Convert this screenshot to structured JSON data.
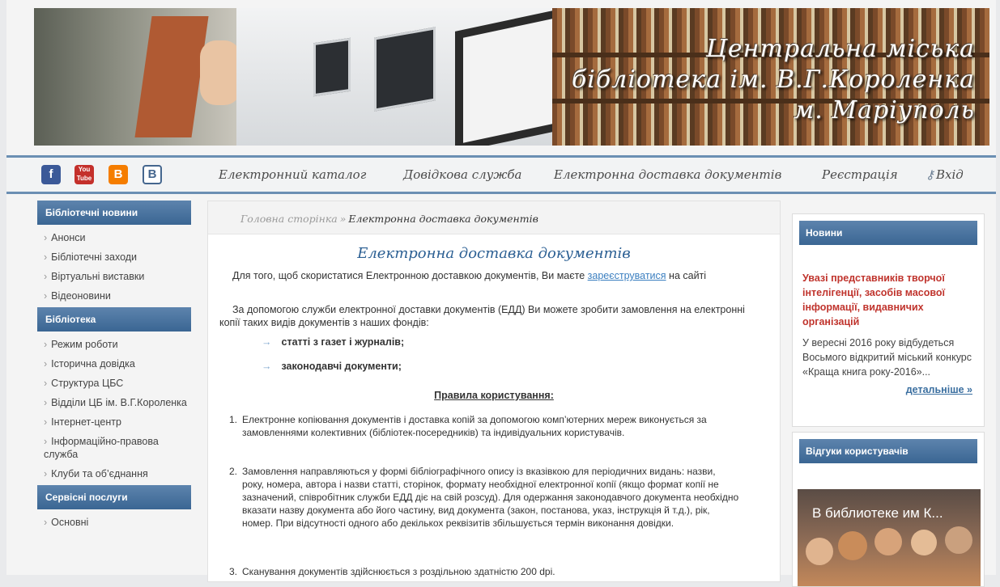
{
  "header": {
    "banner_lines": [
      "Центральна міська",
      "бібліотека ім. В.Г.Короленка",
      "м. Маріуполь"
    ]
  },
  "social": {
    "items": [
      {
        "name": "facebook-icon",
        "glyph": "f"
      },
      {
        "name": "youtube-icon",
        "glyph": "You Tube"
      },
      {
        "name": "blogger-icon",
        "glyph": "B"
      },
      {
        "name": "vkontakte-icon",
        "glyph": "B"
      }
    ]
  },
  "nav": {
    "items": [
      "Електронний каталог",
      "Довідкова служба",
      "Електронна доставка документів",
      "Реєстрація",
      "Вхід"
    ],
    "login_icon": "key-icon"
  },
  "left": {
    "sections": [
      {
        "title": "Бібліотечні новини",
        "items": [
          "Анонси",
          "Бібліотечні заходи",
          "Віртуальні виставки",
          "Відеоновини"
        ]
      },
      {
        "title": "Бібліотека",
        "items": [
          "Режим роботи",
          "Історична довідка",
          "Структура ЦБС",
          "Відділи ЦБ ім. В.Г.Короленка",
          "Інтернет-центр",
          "Інформаційно-правова служба",
          "Клуби та об’єднання"
        ]
      },
      {
        "title": "Сервісні послуги",
        "items": [
          "Основні"
        ]
      }
    ]
  },
  "main": {
    "breadcrumb": {
      "home": "Головна сторінка",
      "sep": "»",
      "current": "Електронна доставка документів"
    },
    "title": "Електронна доставка документів",
    "intro_before": "Для того, щоб скористатися Електронною доставкою документів, Ви маєте ",
    "intro_link": "зареєструватися",
    "intro_after": " на сайті",
    "para2": "За допомогою служби електронної доставки документів (ЕДД) Ви можете зробити замовлення на електронні копії таких видів документів з наших фондів:",
    "bullets": [
      "статті з газет і журналів;",
      "законодавчі документи;"
    ],
    "rules_title": "Правила користування:",
    "rules": [
      "Електронне копіювання документів і доставка копій за допомогою комп’ютерних мереж виконується за замовленнями колективних (бібліотек-посередників) та індивідуальних користувачів.",
      "Замовлення направляються у формі бібліографічного опису із вказівкою для періодичних видань: назви, року, номера, автора і назви статті, сторінок, формату необхідної електронної копії (якщо формат копії не зазначений, співробітник служби ЕДД діє на свій розсуд). Для одержання законодавчого документа необхідно вказати назву документа або його частину, вид документа (закон, постанова, указ, інструкція й т.д.), рік, номер. При відсутності одного або декількох реквізитів збільшується термін виконання довідки.",
      "Сканування документів здійснюється з роздільною здатністю 200 dpi."
    ]
  },
  "right": {
    "news": {
      "title": "Новини",
      "headline": "Увазі представників творчої інтелігенції, засобів масової інформації, видавничих організацій",
      "text": "У вересні 2016 року відбудеться Восьмого відкритий міський конкурс «Краща книга року-2016»...",
      "more": "детальніше »"
    },
    "reviews": {
      "title": "Відгуки користувачів",
      "video_title": "В библиотеке им К..."
    }
  }
}
